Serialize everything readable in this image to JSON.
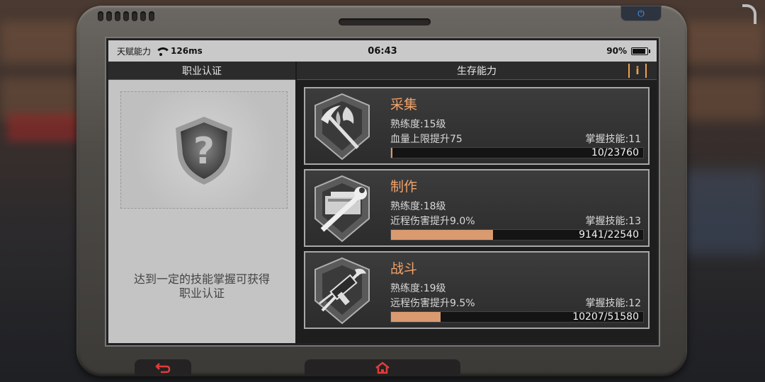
{
  "status_bar": {
    "carrier": "天赋能力",
    "ping": "126ms",
    "time": "06:43",
    "battery": "90%"
  },
  "left_panel": {
    "header": "职业认证",
    "hint_line1": "达到一定的技能掌握可获得",
    "hint_line2": "职业认证"
  },
  "right_panel": {
    "header": "生存能力",
    "info_label": "i"
  },
  "skills": [
    {
      "name": "采集",
      "level": "熟练度:15级",
      "bonus": "血量上限提升75",
      "mastery": "掌握技能:11",
      "progress_text": "10/23760",
      "progress_fraction": 0.0004,
      "icon": "pickaxe-icon"
    },
    {
      "name": "制作",
      "level": "熟练度:18级",
      "bonus": "近程伤害提升9.0%",
      "mastery": "掌握技能:13",
      "progress_text": "9141/22540",
      "progress_fraction": 0.4056,
      "icon": "wrench-icon"
    },
    {
      "name": "战斗",
      "level": "熟练度:19级",
      "bonus": "远程伤害提升9.5%",
      "mastery": "掌握技能:12",
      "progress_text": "10207/51580",
      "progress_fraction": 0.1979,
      "icon": "gun-icon"
    }
  ],
  "nav": {
    "back_icon": "back-arrow-icon",
    "home_icon": "home-icon"
  },
  "colors": {
    "accent": "#f2a46a",
    "progress": "#d99a70",
    "nav_icon": "#e23b3b"
  }
}
